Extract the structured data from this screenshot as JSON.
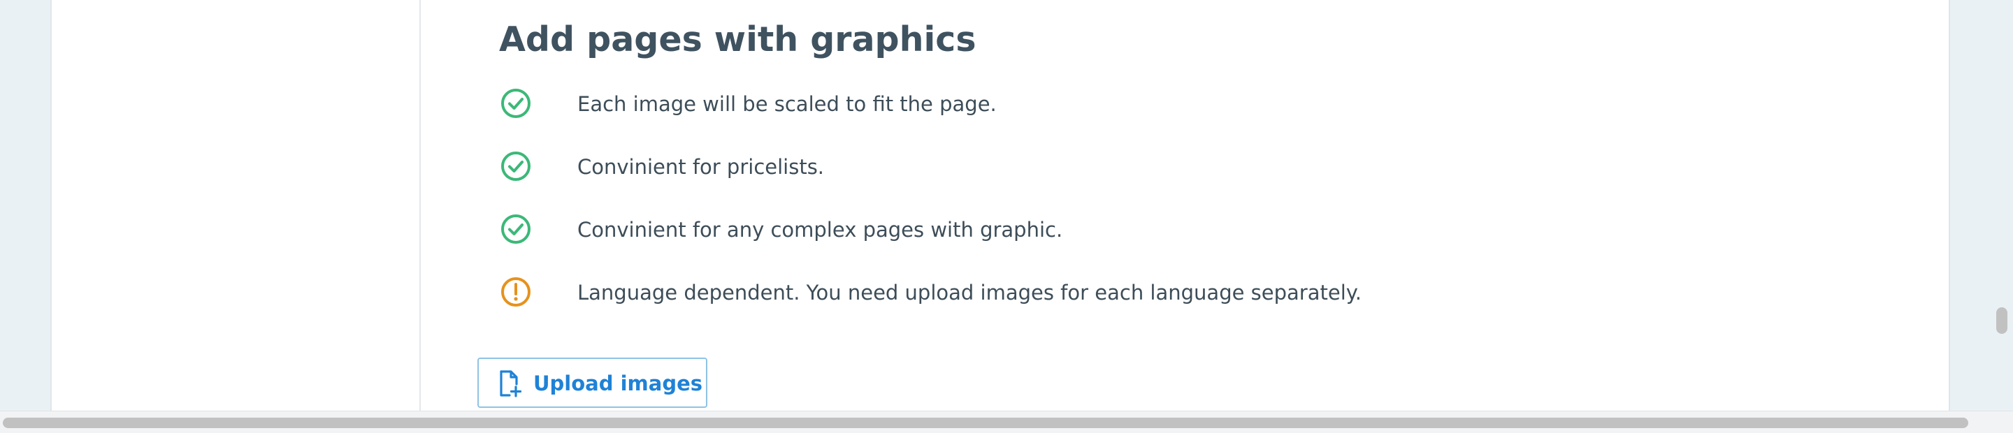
{
  "section": {
    "title": "Add pages with graphics"
  },
  "features": [
    {
      "icon": "check-circle-icon",
      "text": "Each image will be scaled to fit the page."
    },
    {
      "icon": "check-circle-icon",
      "text": "Convinient for pricelists."
    },
    {
      "icon": "check-circle-icon",
      "text": "Convinient for any complex pages with graphic."
    },
    {
      "icon": "warning-circle-icon",
      "text": "Language dependent. You need upload images for each language separately."
    }
  ],
  "upload": {
    "icon": "file-plus-icon",
    "label": "Upload images"
  },
  "colors": {
    "background": "#e9f1f4",
    "panel": "#ffffff",
    "title": "#3f5260",
    "text": "#3d4d58",
    "success": "#3cb878",
    "warning": "#e6921e",
    "accent": "#1f82d6",
    "button_border": "#8fc3e6",
    "scrollbar": "#c1c1c1"
  }
}
